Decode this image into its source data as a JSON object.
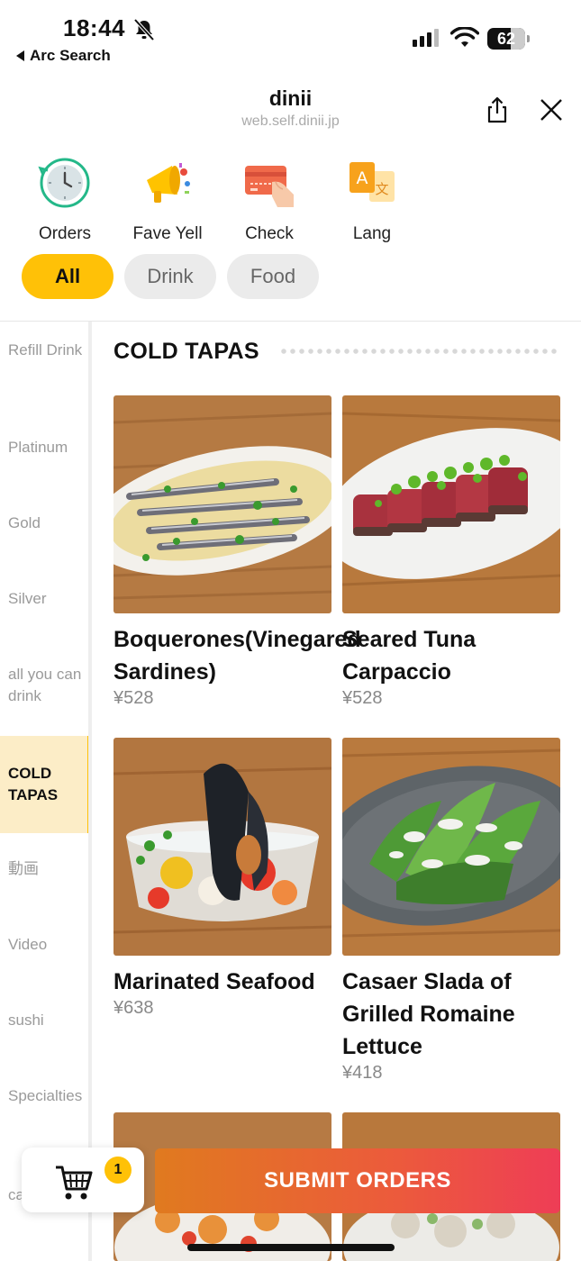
{
  "status_bar": {
    "time": "18:44",
    "back_app": "Arc Search",
    "battery": "62"
  },
  "header": {
    "title": "dinii",
    "url": "web.self.dinii.jp"
  },
  "quick_actions": [
    {
      "label": "Orders",
      "icon": "clock-icon"
    },
    {
      "label": "Fave Yell",
      "icon": "megaphone-icon"
    },
    {
      "label": "Check",
      "icon": "credit-card-icon"
    },
    {
      "label": "Lang",
      "icon": "translate-icon"
    }
  ],
  "filters": [
    {
      "label": "All",
      "active": true
    },
    {
      "label": "Drink",
      "active": false
    },
    {
      "label": "Food",
      "active": false
    }
  ],
  "sidebar": {
    "items": [
      {
        "label": "Refill Drink"
      },
      {
        "label": "Platinum"
      },
      {
        "label": "Gold"
      },
      {
        "label": "Silver"
      },
      {
        "label": "all you can drink"
      },
      {
        "label": "COLD TAPAS",
        "active": true
      },
      {
        "label": "動画"
      },
      {
        "label": "Video"
      },
      {
        "label": "sushi"
      },
      {
        "label": "Specialties"
      },
      {
        "label": "ca"
      }
    ]
  },
  "section": {
    "title": "COLD TAPAS"
  },
  "menu_items": [
    {
      "name": "Boquerones(Vinegared Sardines)",
      "price": "¥528"
    },
    {
      "name": "Seared Tuna Carpaccio",
      "price": "¥528"
    },
    {
      "name": "Marinated Seafood",
      "price": "¥638"
    },
    {
      "name": "Casaer Slada of Grilled Romaine Lettuce",
      "price": "¥418"
    }
  ],
  "cart": {
    "count": "1"
  },
  "submit": {
    "label": "SUBMIT ORDERS"
  },
  "colors": {
    "accent": "#ffc107",
    "submit_start": "#e07a1f",
    "submit_end": "#ee3d56"
  }
}
